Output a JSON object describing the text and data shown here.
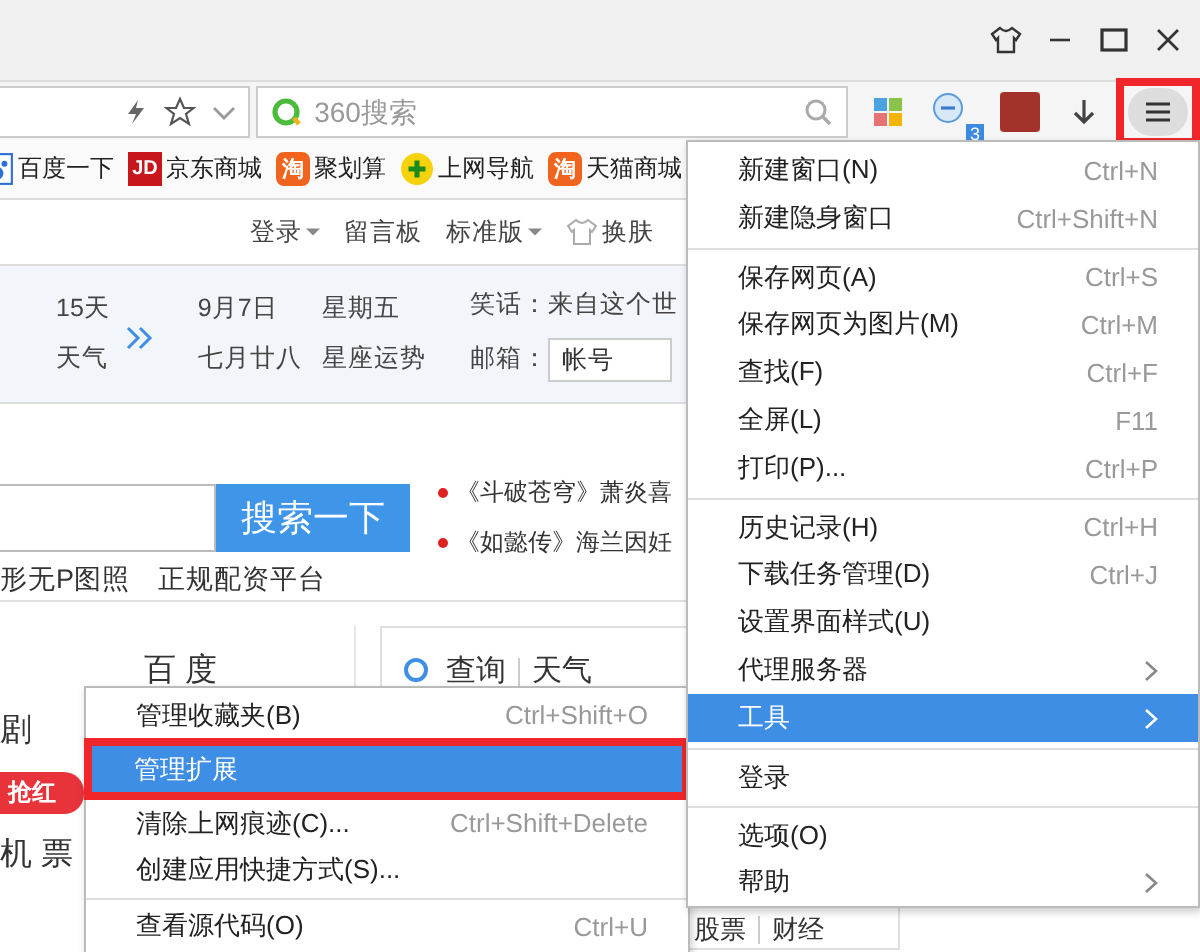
{
  "toolbar": {
    "search_placeholder": "360搜索",
    "notify_count": "3",
    "menu_highlighted": true
  },
  "bookmarks": [
    {
      "kind": "paw",
      "label": "百度一下"
    },
    {
      "kind": "jd",
      "icon_text": "JD",
      "label": "京东商城"
    },
    {
      "kind": "tao",
      "icon_text": "淘",
      "label": "聚划算"
    },
    {
      "kind": "plus",
      "label": "上网导航"
    },
    {
      "kind": "tao",
      "icon_text": "淘",
      "label": "天猫商城"
    }
  ],
  "top_links": [
    {
      "kind": "dropdown",
      "label": "登录"
    },
    {
      "kind": "plain",
      "label": "留言板"
    },
    {
      "kind": "dropdown",
      "label": "标准版"
    },
    {
      "kind": "skin",
      "label": "换肤"
    }
  ],
  "info": {
    "weather_days": "15天",
    "weather": "天气",
    "date": "9月7日",
    "weekday": "星期五",
    "lunar": "七月廿八",
    "horoscope": "星座运势",
    "joke": "笑话：来自这个世",
    "mail_label": "邮箱：",
    "mail_placeholder": "帐号"
  },
  "search": {
    "button": "搜索一下"
  },
  "news": [
    "《斗破苍穹》萧炎喜",
    "《如懿传》海兰因妊"
  ],
  "links": [
    "形无P图照",
    "正规配资平台"
  ],
  "nav": {
    "col1": [
      "剧",
      "机 票"
    ],
    "badge": "抢红",
    "col2": "百 度"
  },
  "query_tabs": [
    "查询",
    "天气"
  ],
  "bottom_tabs": [
    "股票",
    "财经"
  ],
  "main_menu": [
    {
      "label": "新建窗口(N)",
      "shortcut": "Ctrl+N",
      "submenu": false,
      "selected": false,
      "separator_before": false
    },
    {
      "label": "新建隐身窗口",
      "shortcut": "Ctrl+Shift+N",
      "submenu": false,
      "selected": false,
      "separator_before": false
    },
    {
      "label": "保存网页(A)",
      "shortcut": "Ctrl+S",
      "submenu": false,
      "selected": false,
      "separator_before": true
    },
    {
      "label": "保存网页为图片(M)",
      "shortcut": "Ctrl+M",
      "submenu": false,
      "selected": false,
      "separator_before": false
    },
    {
      "label": "查找(F)",
      "shortcut": "Ctrl+F",
      "submenu": false,
      "selected": false,
      "separator_before": false
    },
    {
      "label": "全屏(L)",
      "shortcut": "F11",
      "submenu": false,
      "selected": false,
      "separator_before": false
    },
    {
      "label": "打印(P)...",
      "shortcut": "Ctrl+P",
      "submenu": false,
      "selected": false,
      "separator_before": false
    },
    {
      "label": "历史记录(H)",
      "shortcut": "Ctrl+H",
      "submenu": false,
      "selected": false,
      "separator_before": true
    },
    {
      "label": "下载任务管理(D)",
      "shortcut": "Ctrl+J",
      "submenu": false,
      "selected": false,
      "separator_before": false
    },
    {
      "label": "设置界面样式(U)",
      "submenu": false,
      "selected": false,
      "separator_before": false
    },
    {
      "label": "代理服务器",
      "submenu": true,
      "selected": false,
      "separator_before": false
    },
    {
      "label": "工具",
      "submenu": true,
      "selected": true,
      "separator_before": false
    },
    {
      "label": "登录",
      "submenu": false,
      "selected": false,
      "separator_before": true
    },
    {
      "label": "选项(O)",
      "submenu": false,
      "selected": false,
      "separator_before": true
    },
    {
      "label": "帮助",
      "submenu": true,
      "selected": false,
      "separator_before": false
    }
  ],
  "submenu": [
    {
      "label": "管理收藏夹(B)",
      "shortcut": "Ctrl+Shift+O",
      "selected": false,
      "highlighted": false,
      "separator_before": false
    },
    {
      "label": "管理扩展",
      "selected": true,
      "highlighted": true,
      "separator_before": false
    },
    {
      "label": "清除上网痕迹(C)...",
      "shortcut": "Ctrl+Shift+Delete",
      "selected": false,
      "highlighted": false,
      "separator_before": false
    },
    {
      "label": "创建应用快捷方式(S)...",
      "selected": false,
      "highlighted": false,
      "separator_before": false
    },
    {
      "label": "查看源代码(O)",
      "shortcut": "Ctrl+U",
      "selected": false,
      "highlighted": false,
      "separator_before": true
    }
  ]
}
